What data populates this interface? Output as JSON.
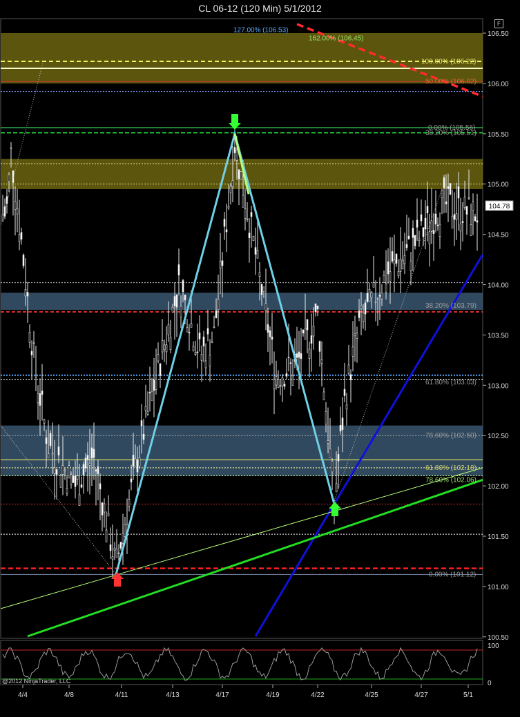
{
  "title": "CL 06-12 (120 Min)  5/1/2012",
  "copyright": "@2012 NinjaTrader, LLC",
  "f_button": "F",
  "current_price": "104.78",
  "chart_data": {
    "type": "candlestick",
    "instrument": "CL 06-12",
    "timeframe": "120 Min",
    "date": "5/1/2012",
    "y_axis": {
      "ticks": [
        "106.50",
        "106.00",
        "105.50",
        "105.00",
        "104.50",
        "104.00",
        "103.50",
        "103.00",
        "102.50",
        "102.00",
        "101.50",
        "101.00",
        "100.50"
      ],
      "ylim": [
        100.5,
        106.5
      ]
    },
    "x_axis": {
      "ticks": [
        "4/4",
        "4/8",
        "4/11",
        "4/13",
        "4/17",
        "4/19",
        "4/22",
        "4/25",
        "4/27",
        "5/1"
      ]
    },
    "zones": [
      {
        "from": 106.0,
        "to": 106.5,
        "color": "#6b6410"
      },
      {
        "from": 104.95,
        "to": 105.25,
        "color": "#6b6410"
      },
      {
        "from": 103.75,
        "to": 103.92,
        "color": "#3a5670"
      },
      {
        "from": 102.1,
        "to": 102.6,
        "color": "#3a5670"
      }
    ],
    "fib_labels": [
      {
        "text": "127.00% (106.53)",
        "value": 106.53,
        "color": "#5aa9ff"
      },
      {
        "text": "162.00% (106.45)",
        "value": 106.45,
        "color": "#9be36b"
      },
      {
        "text": "100.00% (106.22)",
        "value": 106.22,
        "color": "#e8e86b"
      },
      {
        "text": "50.00% (106.02)",
        "value": 106.02,
        "color": "#e06a30"
      },
      {
        "text": "0.00% (105.56)",
        "value": 105.56,
        "color": "#9a9a9a"
      },
      {
        "text": "38.20% (105.51)",
        "value": 105.51,
        "color": "#9a9a9a"
      },
      {
        "text": "38.20% (103.79)",
        "value": 103.79,
        "color": "#9a9a9a"
      },
      {
        "text": "61.80% (103.03)",
        "value": 103.03,
        "color": "#9a9a9a"
      },
      {
        "text": "78.60% (102.50)",
        "value": 102.5,
        "color": "#9a9a9a"
      },
      {
        "text": "61.80% (102.18)",
        "value": 102.18,
        "color": "#c8c86b"
      },
      {
        "text": "78.60% (102.06)",
        "value": 102.06,
        "color": "#9be36b"
      },
      {
        "text": "0.00% (101.12)",
        "value": 101.12,
        "color": "#9a9a9a"
      }
    ],
    "pattern_points": [
      {
        "date": "4/11",
        "price": 101.12
      },
      {
        "date": "4/17",
        "price": 105.5
      },
      {
        "date": "4/22",
        "price": 101.82
      }
    ],
    "oscillator": {
      "ticks": [
        "100",
        "0"
      ],
      "ylim": [
        0,
        100
      ]
    }
  }
}
